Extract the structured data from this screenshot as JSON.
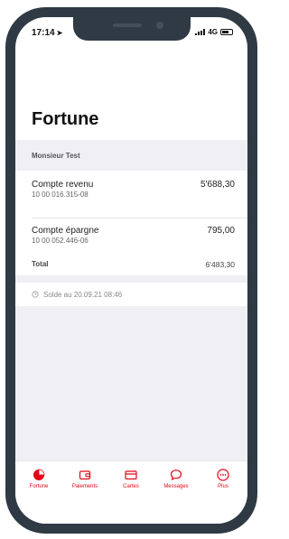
{
  "status_bar": {
    "time": "17:14",
    "network": "4G"
  },
  "page": {
    "title": "Fortune"
  },
  "owner": {
    "name": "Monsieur Test"
  },
  "accounts": [
    {
      "name": "Compte revenu",
      "number": "10 00 016.315-08",
      "amount": "5'688,30"
    },
    {
      "name": "Compte épargne",
      "number": "10 00 052.446-06",
      "amount": "795,00"
    }
  ],
  "total": {
    "label": "Total",
    "amount": "6'483,30"
  },
  "balance": {
    "text": "Solde au 20.09.21 08:46"
  },
  "tabs": [
    {
      "label": "Fortune",
      "icon": "pie-chart-icon"
    },
    {
      "label": "Paiements",
      "icon": "wallet-icon"
    },
    {
      "label": "Cartes",
      "icon": "credit-card-icon"
    },
    {
      "label": "Messages",
      "icon": "chat-bubble-icon"
    },
    {
      "label": "Plus",
      "icon": "more-icon"
    }
  ],
  "colors": {
    "accent": "#e30613",
    "background": "#efeff4",
    "frame": "#2f3a44"
  }
}
